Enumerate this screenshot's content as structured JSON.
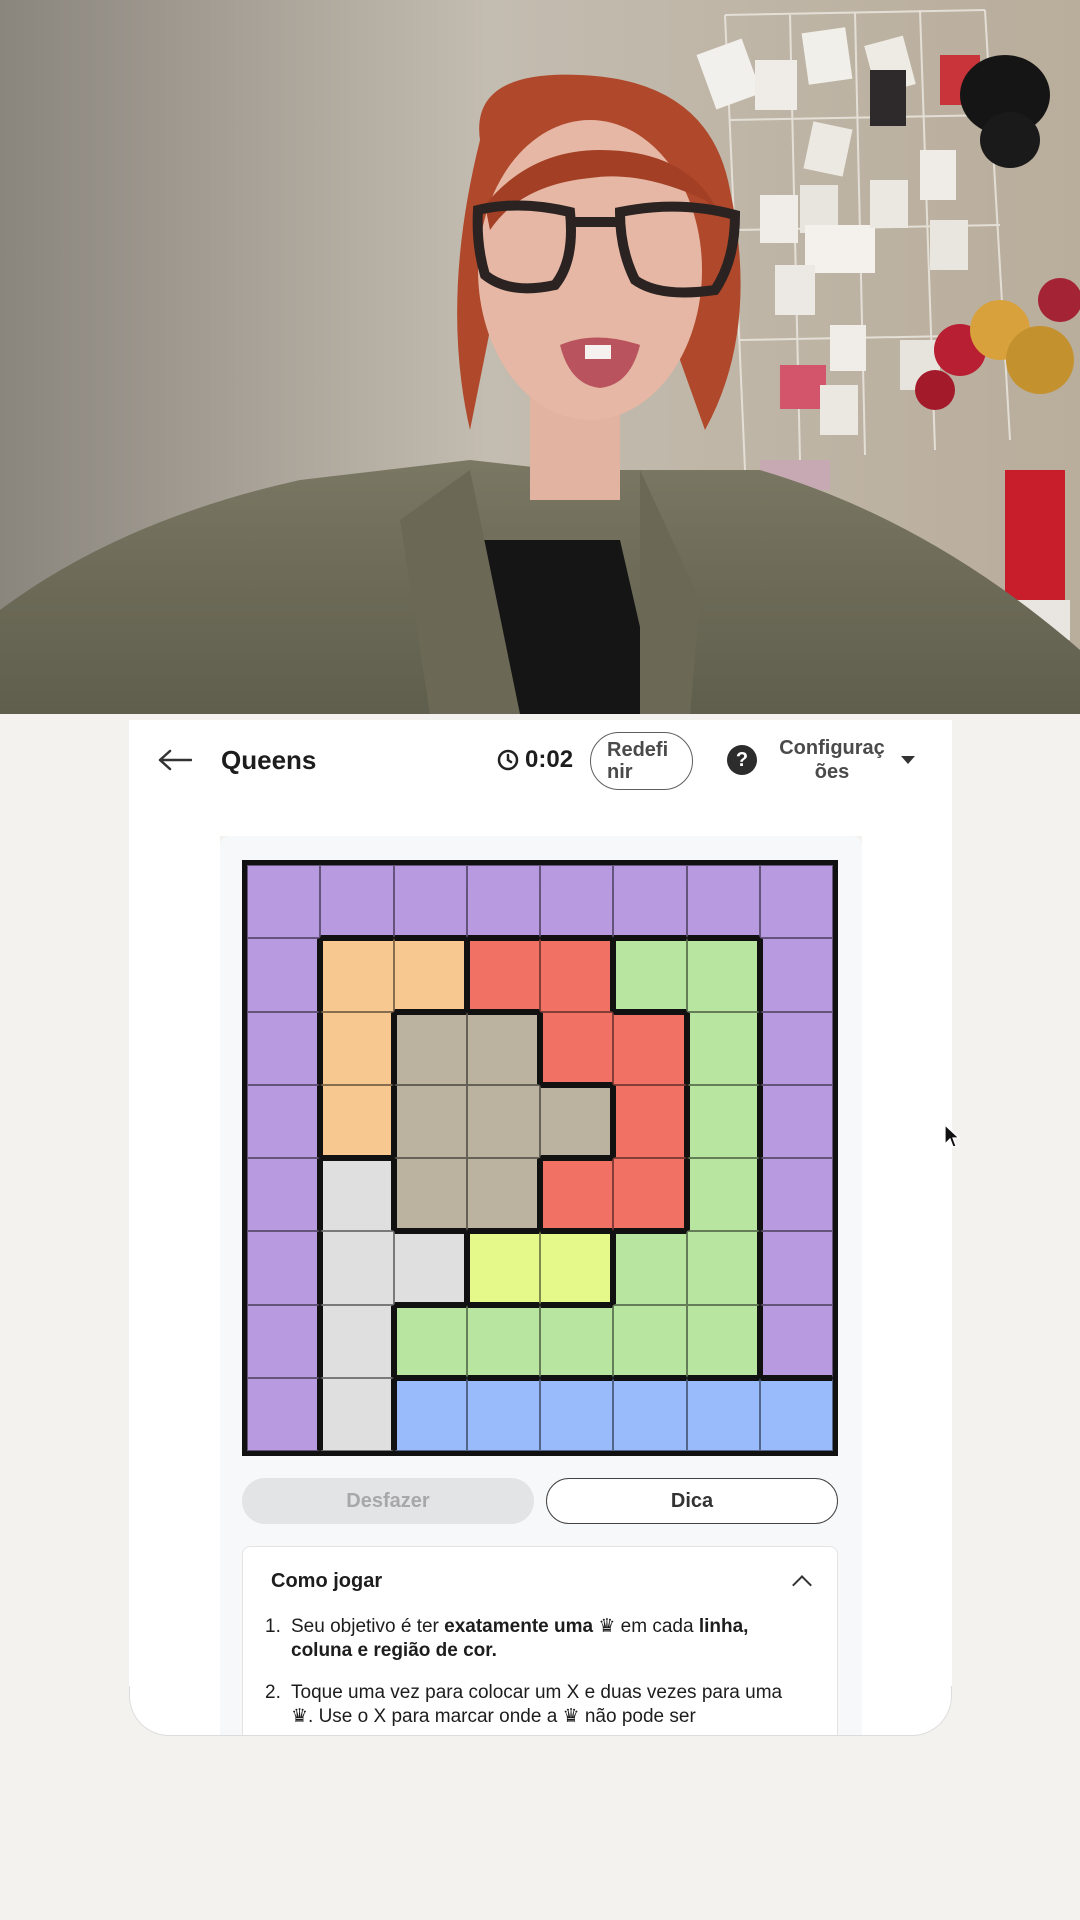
{
  "header": {
    "title": "Queens",
    "timer": "0:02",
    "reset_label": "Redefi\nnir",
    "help_symbol": "?",
    "settings_label": "Configurações"
  },
  "colors": {
    "purple": "#b89ae0",
    "orange": "#f8c891",
    "red": "#f17265",
    "green": "#b8e6a1",
    "taupe": "#bbb2a0",
    "gray": "#dfdfdf",
    "yellow": "#e5f88a",
    "blue": "#99bbfb"
  },
  "board": {
    "size": 8,
    "regions": [
      [
        "purple",
        "purple",
        "purple",
        "purple",
        "purple",
        "purple",
        "purple",
        "purple"
      ],
      [
        "purple",
        "orange",
        "orange",
        "red",
        "red",
        "green",
        "green",
        "purple"
      ],
      [
        "purple",
        "orange",
        "taupe",
        "taupe",
        "red",
        "red",
        "green",
        "purple"
      ],
      [
        "purple",
        "orange",
        "taupe",
        "taupe",
        "taupe",
        "red",
        "green",
        "purple"
      ],
      [
        "purple",
        "gray",
        "taupe",
        "taupe",
        "red",
        "red",
        "green",
        "purple"
      ],
      [
        "purple",
        "gray",
        "gray",
        "yellow",
        "yellow",
        "green",
        "green",
        "purple"
      ],
      [
        "purple",
        "gray",
        "green",
        "green",
        "green",
        "green",
        "green",
        "purple"
      ],
      [
        "purple",
        "gray",
        "blue",
        "blue",
        "blue",
        "blue",
        "blue",
        "blue"
      ]
    ]
  },
  "actions": {
    "undo_label": "Desfazer",
    "hint_label": "Dica"
  },
  "how_to_play": {
    "title": "Como jogar",
    "rules": [
      {
        "num": "1.",
        "parts": [
          {
            "t": "Seu objetivo é ter "
          },
          {
            "t": "exatamente uma",
            "b": true
          },
          {
            "t": " ♛ em cada "
          },
          {
            "t": "linha, coluna e região de cor.",
            "b": true
          }
        ]
      },
      {
        "num": "2.",
        "parts": [
          {
            "t": "Toque uma vez para colocar um X e duas vezes para uma ♛. Use o X para marcar onde a ♛ não pode ser"
          }
        ]
      }
    ]
  }
}
